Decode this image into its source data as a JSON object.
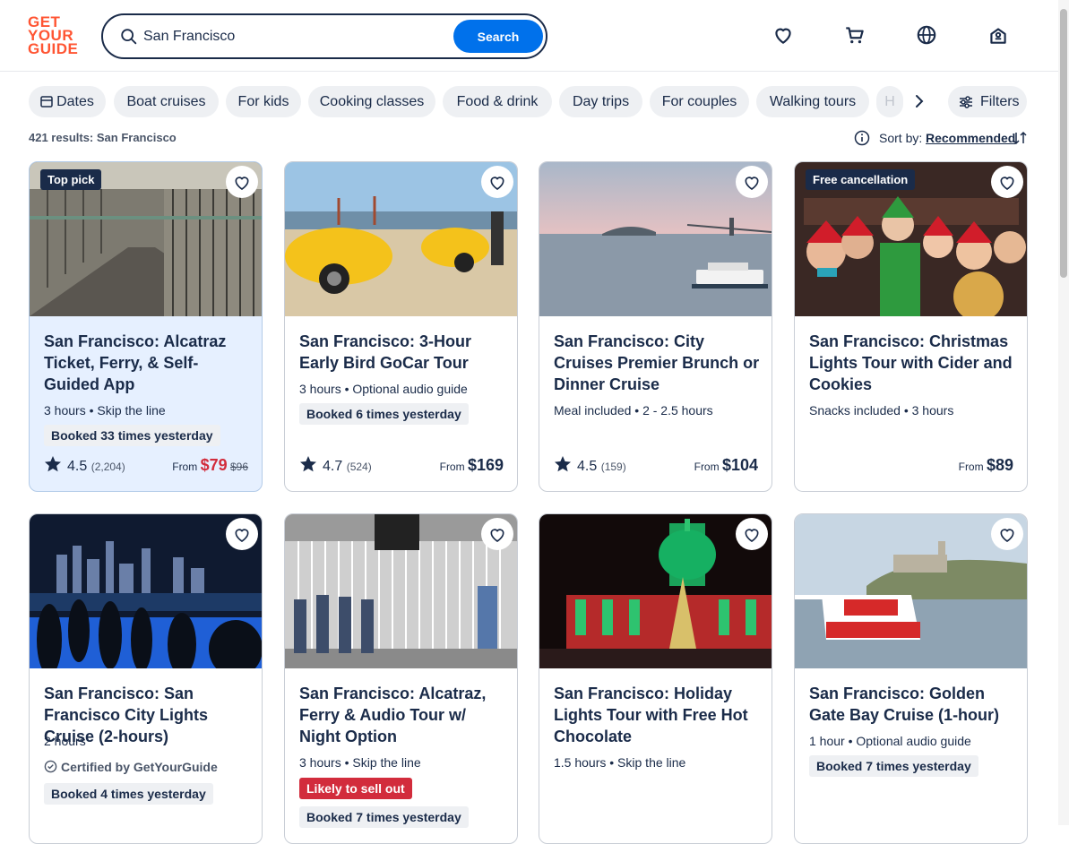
{
  "logo": {
    "lines": [
      "GET",
      "YOUR",
      "GUIDE"
    ]
  },
  "search": {
    "value": "San Francisco",
    "button": "Search"
  },
  "chips": {
    "dates": "Dates",
    "items": [
      "Boat cruises",
      "For kids",
      "Cooking classes",
      "Food & drink",
      "Day trips",
      "For couples",
      "Walking tours",
      "H"
    ],
    "filters": "Filters"
  },
  "results": {
    "text": "421 results: San Francisco",
    "sort_label": "Sort by:",
    "sort_value": "Recommended"
  },
  "colors": {
    "brand": "#ff5533",
    "primary": "#0071eb",
    "sale": "#d22c3c",
    "dark": "#1a2b49"
  },
  "cards": [
    {
      "badge": "Top pick",
      "title": "San Francisco: Alcatraz Ticket, Ferry, & Self-Guided App",
      "meta": "3 hours • Skip the line",
      "booked": "Booked 33 times yesterday",
      "rating": "4.5",
      "count": "(2,204)",
      "from": "From",
      "price": "$79",
      "old_price": "$96"
    },
    {
      "title": "San Francisco: 3-Hour Early Bird GoCar Tour",
      "meta": "3 hours • Optional audio guide",
      "booked": "Booked 6 times yesterday",
      "rating": "4.7",
      "count": "(524)",
      "from": "From",
      "price": "$169"
    },
    {
      "title": "San Francisco: City Cruises Premier Brunch or Dinner Cruise",
      "meta": "Meal included • 2 - 2.5 hours",
      "rating": "4.5",
      "count": "(159)",
      "from": "From",
      "price": "$104"
    },
    {
      "badge": "Free cancellation",
      "title": "San Francisco: Christmas Lights Tour with Cider and Cookies",
      "meta": "Snacks included • 3 hours",
      "from": "From",
      "price": "$89"
    },
    {
      "title": "San Francisco: San Francisco City Lights Cruise (2-hours)",
      "meta": "2 hours",
      "certified": "Certified by GetYourGuide",
      "booked": "Booked 4 times yesterday"
    },
    {
      "title": "San Francisco: Alcatraz, Ferry & Audio Tour w/ Night Option",
      "meta": "3 hours • Skip the line",
      "alert": "Likely to sell out",
      "booked": "Booked 7 times yesterday"
    },
    {
      "title": "San Francisco: Holiday Lights Tour with Free Hot Chocolate",
      "meta": "1.5 hours • Skip the line"
    },
    {
      "title": "San Francisco: Golden Gate Bay Cruise (1-hour)",
      "meta": "1 hour • Optional audio guide",
      "booked": "Booked 7 times yesterday"
    }
  ]
}
